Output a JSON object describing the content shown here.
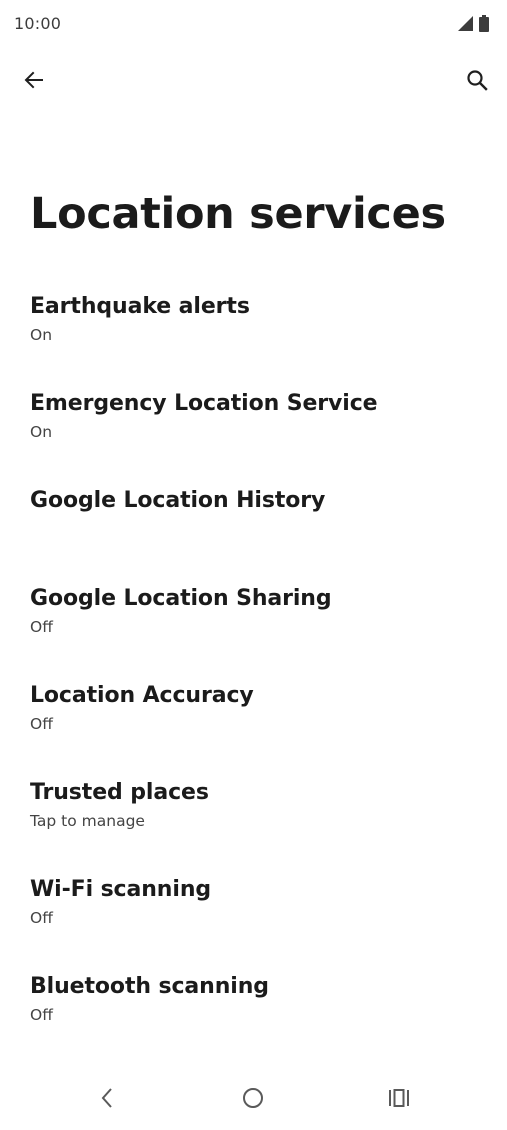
{
  "status_bar": {
    "time": "10:00",
    "icons": [
      "signal-icon",
      "battery-icon"
    ]
  },
  "app_bar": {
    "back_icon": "arrow-back-icon",
    "search_icon": "search-icon"
  },
  "page": {
    "title": "Location services"
  },
  "settings": {
    "items": [
      {
        "title": "Earthquake alerts",
        "summary": "On"
      },
      {
        "title": "Emergency Location Service",
        "summary": "On"
      },
      {
        "title": "Google Location History",
        "summary": ""
      },
      {
        "title": "Google Location Sharing",
        "summary": "Off"
      },
      {
        "title": "Location Accuracy",
        "summary": "Off"
      },
      {
        "title": "Trusted places",
        "summary": "Tap to manage"
      },
      {
        "title": "Wi-Fi scanning",
        "summary": "Off"
      },
      {
        "title": "Bluetooth scanning",
        "summary": "Off"
      }
    ]
  },
  "nav_bar": {
    "icons": [
      "nav-back-icon",
      "nav-home-icon",
      "nav-recents-icon"
    ]
  },
  "colors": {
    "background": "#ffffff",
    "title": "#1b1b1b",
    "summary": "#444444",
    "icon": "#3c3c3c"
  }
}
